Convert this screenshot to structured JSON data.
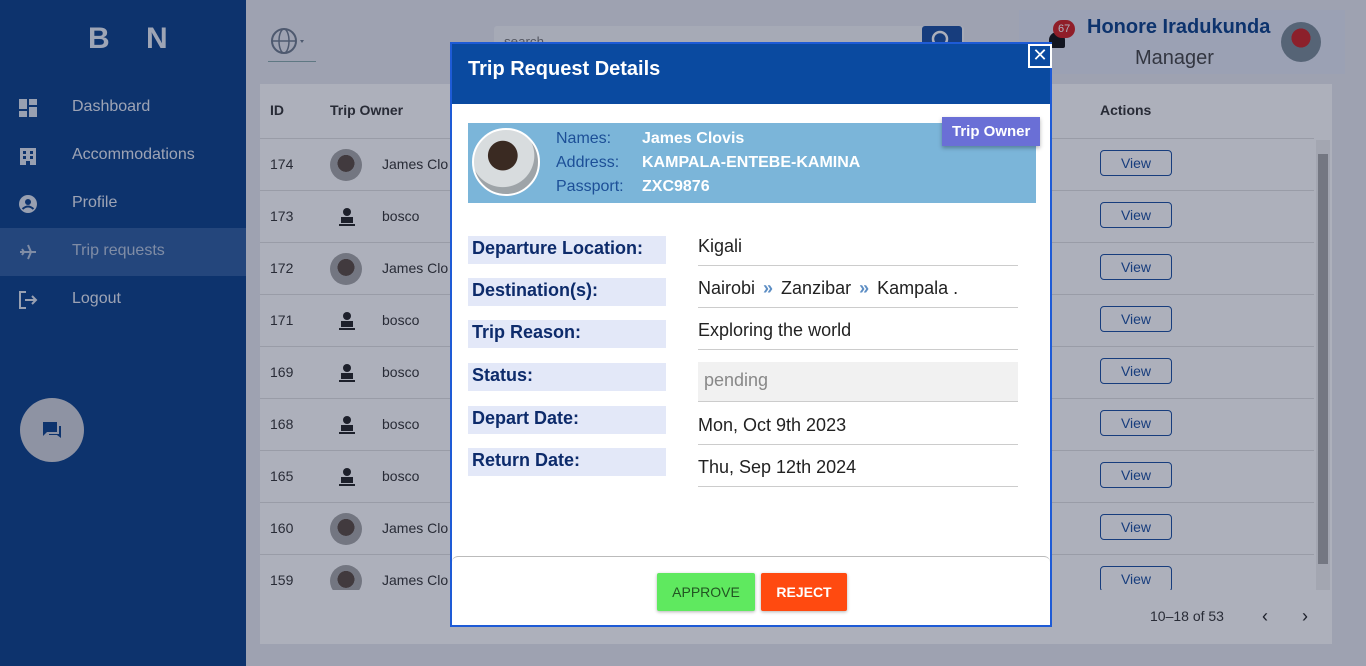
{
  "app": {
    "logo": "B N"
  },
  "sidebar": {
    "items": [
      {
        "label": "Dashboard",
        "icon": "dashboard-icon"
      },
      {
        "label": "Accommodations",
        "icon": "building-icon"
      },
      {
        "label": "Profile",
        "icon": "account-circle-icon"
      },
      {
        "label": "Trip requests",
        "icon": "flight-icon",
        "active": true
      },
      {
        "label": "Logout",
        "icon": "logout-icon"
      }
    ]
  },
  "header": {
    "search_placeholder": "search",
    "notification_count": "67",
    "user_name": "Honore Iradukunda",
    "user_role": "Manager"
  },
  "table": {
    "columns": [
      "ID",
      "Trip Owner",
      "Actions"
    ],
    "rows": [
      {
        "id": "174",
        "owner": "James Clo",
        "has_photo": true,
        "action": "View"
      },
      {
        "id": "173",
        "owner": "bosco",
        "has_photo": false,
        "action": "View"
      },
      {
        "id": "172",
        "owner": "James Clo",
        "has_photo": true,
        "action": "View"
      },
      {
        "id": "171",
        "owner": "bosco",
        "has_photo": false,
        "action": "View"
      },
      {
        "id": "169",
        "owner": "bosco",
        "has_photo": false,
        "action": "View"
      },
      {
        "id": "168",
        "owner": "bosco",
        "has_photo": false,
        "action": "View"
      },
      {
        "id": "165",
        "owner": "bosco",
        "has_photo": false,
        "action": "View"
      },
      {
        "id": "160",
        "owner": "James Clo",
        "has_photo": true,
        "action": "View"
      },
      {
        "id": "159",
        "owner": "James Clo",
        "has_photo": true,
        "action": "View"
      }
    ],
    "pagination": {
      "range": "10–18 of 53"
    }
  },
  "modal": {
    "title": "Trip Request Details",
    "close": "✕",
    "owner_tag": "Trip Owner",
    "owner": {
      "names_label": "Names:",
      "names": "James Clovis",
      "address_label": "Address:",
      "address": "KAMPALA-ENTEBE-KAMINA",
      "passport_label": "Passport:",
      "passport": "ZXC9876"
    },
    "details": {
      "departure_label": "Departure Location:",
      "departure": "Kigali",
      "destinations_label": "Destination(s):",
      "destinations": [
        "Nairobi",
        "Zanzibar",
        "Kampala ."
      ],
      "reason_label": "Trip Reason:",
      "reason": "Exploring the world",
      "status_label": "Status:",
      "status": "pending",
      "depart_date_label": "Depart Date:",
      "depart_date": "Mon, Oct 9th 2023",
      "return_date_label": "Return Date:",
      "return_date": "Thu, Sep 12th 2024"
    },
    "approve_label": "APPROVE",
    "reject_label": "REJECT"
  },
  "colors": {
    "sidebar_bg": "#0a3f87",
    "modal_header": "#0a4aa0",
    "banner_bg": "#7bb5d9",
    "approve": "#5fe95f",
    "reject": "#ff4a10",
    "tag": "#6a6fd6"
  }
}
